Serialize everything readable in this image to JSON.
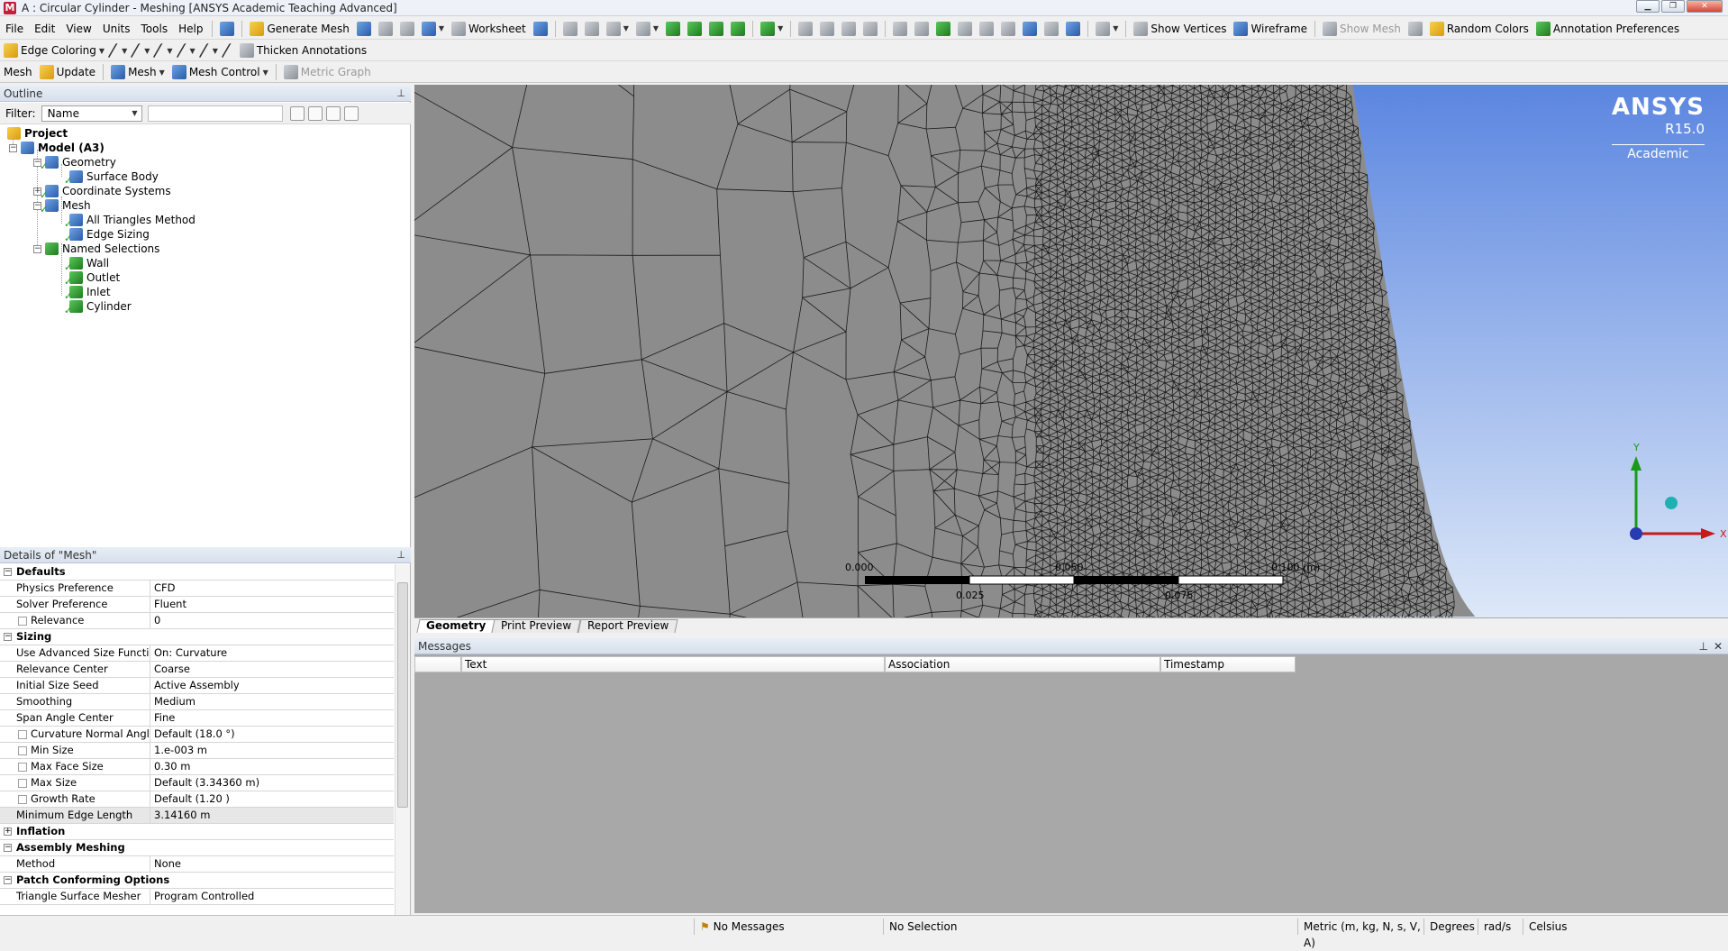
{
  "window": {
    "title": "A : Circular Cylinder - Meshing [ANSYS Academic Teaching Advanced]",
    "app_icon": "M"
  },
  "menu": [
    "File",
    "Edit",
    "View",
    "Units",
    "Tools",
    "Help"
  ],
  "toolbar1": {
    "generate_mesh": "Generate Mesh",
    "worksheet": "Worksheet",
    "show_vertices": "Show Vertices",
    "wireframe": "Wireframe",
    "show_mesh": "Show Mesh",
    "random_colors": "Random Colors",
    "annotation_preferences": "Annotation Preferences"
  },
  "toolbar2": {
    "edge_coloring": "Edge Coloring",
    "thicken_annotations": "Thicken Annotations"
  },
  "toolbar3": {
    "mesh": "Mesh",
    "update": "Update",
    "mesh_menu": "Mesh",
    "mesh_control": "Mesh Control",
    "metric_graph": "Metric Graph"
  },
  "outline": {
    "title": "Outline",
    "filter_label": "Filter:",
    "filter_value": "Name",
    "tree": [
      {
        "label": "Project",
        "bold": true
      },
      {
        "label": "Model (A3)",
        "bold": true
      },
      {
        "label": "Geometry"
      },
      {
        "label": "Surface Body"
      },
      {
        "label": "Coordinate Systems"
      },
      {
        "label": "Mesh"
      },
      {
        "label": "All Triangles Method"
      },
      {
        "label": "Edge Sizing"
      },
      {
        "label": "Named Selections"
      },
      {
        "label": "Wall"
      },
      {
        "label": "Outlet"
      },
      {
        "label": "Inlet"
      },
      {
        "label": "Cylinder"
      }
    ]
  },
  "details": {
    "title": "Details of \"Mesh\"",
    "rows": [
      {
        "type": "section",
        "label": "Defaults",
        "exp": "-"
      },
      {
        "label": "Physics Preference",
        "value": "CFD"
      },
      {
        "label": "Solver Preference",
        "value": "Fluent"
      },
      {
        "label": "Relevance",
        "value": "0",
        "cb": true
      },
      {
        "type": "section",
        "label": "Sizing",
        "exp": "-"
      },
      {
        "label": "Use Advanced Size Function",
        "value": "On: Curvature"
      },
      {
        "label": "Relevance Center",
        "value": "Coarse"
      },
      {
        "label": "Initial Size Seed",
        "value": "Active Assembly"
      },
      {
        "label": "Smoothing",
        "value": "Medium"
      },
      {
        "label": "Span Angle Center",
        "value": "Fine"
      },
      {
        "label": "Curvature Normal Angle",
        "value": "Default (18.0 °)",
        "cb": true
      },
      {
        "label": "Min Size",
        "value": "1.e-003 m",
        "cb": true
      },
      {
        "label": "Max Face Size",
        "value": "0.30 m",
        "cb": true
      },
      {
        "label": "Max Size",
        "value": "Default (3.34360 m)",
        "cb": true
      },
      {
        "label": "Growth Rate",
        "value": "Default (1.20 )",
        "cb": true
      },
      {
        "label": "Minimum Edge Length",
        "value": "3.14160 m",
        "hl": true
      },
      {
        "type": "section",
        "label": "Inflation",
        "exp": "+"
      },
      {
        "type": "section",
        "label": "Assembly Meshing",
        "exp": "-"
      },
      {
        "label": "Method",
        "value": "None"
      },
      {
        "type": "section",
        "label": "Patch Conforming Options",
        "exp": "-"
      },
      {
        "label": "Triangle Surface Mesher",
        "value": "Program Controlled"
      }
    ]
  },
  "viewport": {
    "brand": "ANSYS",
    "version": "R15.0",
    "edition": "Academic",
    "scale_labels": [
      "0.000",
      "0.050",
      "0.100 (m)",
      "0.025",
      "0.075"
    ],
    "axis_y": "Y",
    "axis_x": "X"
  },
  "view_tabs": [
    "Geometry",
    "Print Preview",
    "Report Preview"
  ],
  "messages": {
    "title": "Messages",
    "columns": [
      "Text",
      "Association",
      "Timestamp"
    ]
  },
  "status": {
    "messages": "No Messages",
    "selection": "No Selection",
    "units": "Metric (m, kg, N, s, V, A)",
    "angle": "Degrees",
    "rate": "rad/s",
    "temp": "Celsius"
  },
  "colors": {
    "mesh_fill": "#8c8c8c",
    "mesh_line": "#1a1a1a",
    "background_top": "#5b86e0",
    "accent": "#1f7a1f"
  }
}
